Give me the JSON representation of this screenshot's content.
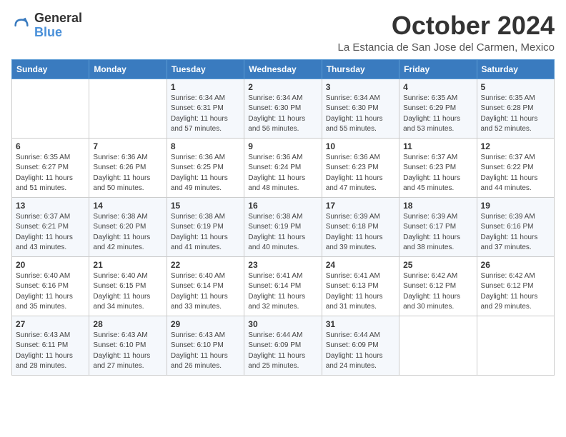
{
  "header": {
    "logo_general": "General",
    "logo_blue": "Blue",
    "month_title": "October 2024",
    "location": "La Estancia de San Jose del Carmen, Mexico"
  },
  "weekdays": [
    "Sunday",
    "Monday",
    "Tuesday",
    "Wednesday",
    "Thursday",
    "Friday",
    "Saturday"
  ],
  "weeks": [
    [
      {
        "day": "",
        "sunrise": "",
        "sunset": "",
        "daylight": ""
      },
      {
        "day": "",
        "sunrise": "",
        "sunset": "",
        "daylight": ""
      },
      {
        "day": "1",
        "sunrise": "Sunrise: 6:34 AM",
        "sunset": "Sunset: 6:31 PM",
        "daylight": "Daylight: 11 hours and 57 minutes."
      },
      {
        "day": "2",
        "sunrise": "Sunrise: 6:34 AM",
        "sunset": "Sunset: 6:30 PM",
        "daylight": "Daylight: 11 hours and 56 minutes."
      },
      {
        "day": "3",
        "sunrise": "Sunrise: 6:34 AM",
        "sunset": "Sunset: 6:30 PM",
        "daylight": "Daylight: 11 hours and 55 minutes."
      },
      {
        "day": "4",
        "sunrise": "Sunrise: 6:35 AM",
        "sunset": "Sunset: 6:29 PM",
        "daylight": "Daylight: 11 hours and 53 minutes."
      },
      {
        "day": "5",
        "sunrise": "Sunrise: 6:35 AM",
        "sunset": "Sunset: 6:28 PM",
        "daylight": "Daylight: 11 hours and 52 minutes."
      }
    ],
    [
      {
        "day": "6",
        "sunrise": "Sunrise: 6:35 AM",
        "sunset": "Sunset: 6:27 PM",
        "daylight": "Daylight: 11 hours and 51 minutes."
      },
      {
        "day": "7",
        "sunrise": "Sunrise: 6:36 AM",
        "sunset": "Sunset: 6:26 PM",
        "daylight": "Daylight: 11 hours and 50 minutes."
      },
      {
        "day": "8",
        "sunrise": "Sunrise: 6:36 AM",
        "sunset": "Sunset: 6:25 PM",
        "daylight": "Daylight: 11 hours and 49 minutes."
      },
      {
        "day": "9",
        "sunrise": "Sunrise: 6:36 AM",
        "sunset": "Sunset: 6:24 PM",
        "daylight": "Daylight: 11 hours and 48 minutes."
      },
      {
        "day": "10",
        "sunrise": "Sunrise: 6:36 AM",
        "sunset": "Sunset: 6:23 PM",
        "daylight": "Daylight: 11 hours and 47 minutes."
      },
      {
        "day": "11",
        "sunrise": "Sunrise: 6:37 AM",
        "sunset": "Sunset: 6:23 PM",
        "daylight": "Daylight: 11 hours and 45 minutes."
      },
      {
        "day": "12",
        "sunrise": "Sunrise: 6:37 AM",
        "sunset": "Sunset: 6:22 PM",
        "daylight": "Daylight: 11 hours and 44 minutes."
      }
    ],
    [
      {
        "day": "13",
        "sunrise": "Sunrise: 6:37 AM",
        "sunset": "Sunset: 6:21 PM",
        "daylight": "Daylight: 11 hours and 43 minutes."
      },
      {
        "day": "14",
        "sunrise": "Sunrise: 6:38 AM",
        "sunset": "Sunset: 6:20 PM",
        "daylight": "Daylight: 11 hours and 42 minutes."
      },
      {
        "day": "15",
        "sunrise": "Sunrise: 6:38 AM",
        "sunset": "Sunset: 6:19 PM",
        "daylight": "Daylight: 11 hours and 41 minutes."
      },
      {
        "day": "16",
        "sunrise": "Sunrise: 6:38 AM",
        "sunset": "Sunset: 6:19 PM",
        "daylight": "Daylight: 11 hours and 40 minutes."
      },
      {
        "day": "17",
        "sunrise": "Sunrise: 6:39 AM",
        "sunset": "Sunset: 6:18 PM",
        "daylight": "Daylight: 11 hours and 39 minutes."
      },
      {
        "day": "18",
        "sunrise": "Sunrise: 6:39 AM",
        "sunset": "Sunset: 6:17 PM",
        "daylight": "Daylight: 11 hours and 38 minutes."
      },
      {
        "day": "19",
        "sunrise": "Sunrise: 6:39 AM",
        "sunset": "Sunset: 6:16 PM",
        "daylight": "Daylight: 11 hours and 37 minutes."
      }
    ],
    [
      {
        "day": "20",
        "sunrise": "Sunrise: 6:40 AM",
        "sunset": "Sunset: 6:16 PM",
        "daylight": "Daylight: 11 hours and 35 minutes."
      },
      {
        "day": "21",
        "sunrise": "Sunrise: 6:40 AM",
        "sunset": "Sunset: 6:15 PM",
        "daylight": "Daylight: 11 hours and 34 minutes."
      },
      {
        "day": "22",
        "sunrise": "Sunrise: 6:40 AM",
        "sunset": "Sunset: 6:14 PM",
        "daylight": "Daylight: 11 hours and 33 minutes."
      },
      {
        "day": "23",
        "sunrise": "Sunrise: 6:41 AM",
        "sunset": "Sunset: 6:14 PM",
        "daylight": "Daylight: 11 hours and 32 minutes."
      },
      {
        "day": "24",
        "sunrise": "Sunrise: 6:41 AM",
        "sunset": "Sunset: 6:13 PM",
        "daylight": "Daylight: 11 hours and 31 minutes."
      },
      {
        "day": "25",
        "sunrise": "Sunrise: 6:42 AM",
        "sunset": "Sunset: 6:12 PM",
        "daylight": "Daylight: 11 hours and 30 minutes."
      },
      {
        "day": "26",
        "sunrise": "Sunrise: 6:42 AM",
        "sunset": "Sunset: 6:12 PM",
        "daylight": "Daylight: 11 hours and 29 minutes."
      }
    ],
    [
      {
        "day": "27",
        "sunrise": "Sunrise: 6:43 AM",
        "sunset": "Sunset: 6:11 PM",
        "daylight": "Daylight: 11 hours and 28 minutes."
      },
      {
        "day": "28",
        "sunrise": "Sunrise: 6:43 AM",
        "sunset": "Sunset: 6:10 PM",
        "daylight": "Daylight: 11 hours and 27 minutes."
      },
      {
        "day": "29",
        "sunrise": "Sunrise: 6:43 AM",
        "sunset": "Sunset: 6:10 PM",
        "daylight": "Daylight: 11 hours and 26 minutes."
      },
      {
        "day": "30",
        "sunrise": "Sunrise: 6:44 AM",
        "sunset": "Sunset: 6:09 PM",
        "daylight": "Daylight: 11 hours and 25 minutes."
      },
      {
        "day": "31",
        "sunrise": "Sunrise: 6:44 AM",
        "sunset": "Sunset: 6:09 PM",
        "daylight": "Daylight: 11 hours and 24 minutes."
      },
      {
        "day": "",
        "sunrise": "",
        "sunset": "",
        "daylight": ""
      },
      {
        "day": "",
        "sunrise": "",
        "sunset": "",
        "daylight": ""
      }
    ]
  ]
}
